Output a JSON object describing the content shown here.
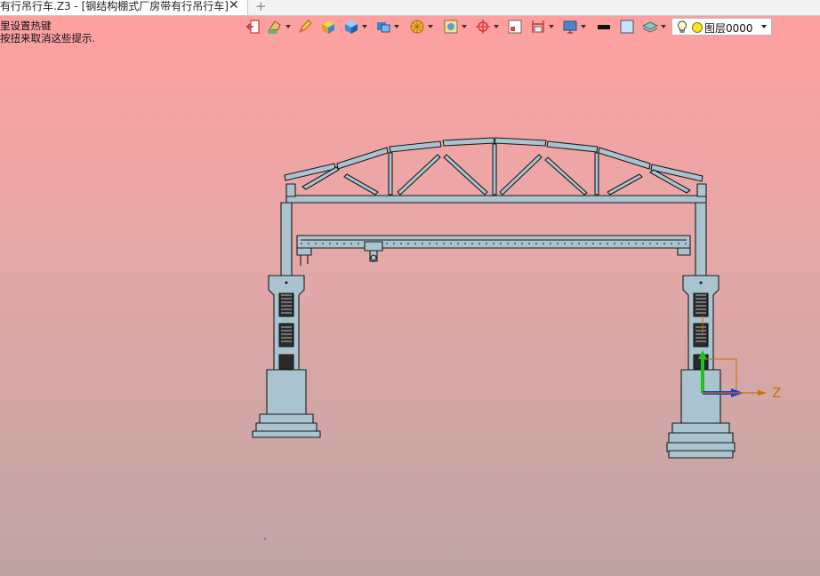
{
  "tab": {
    "title": "有行吊行车.Z3 - [钢结构棚式厂房带有行吊行车]",
    "close_glyph": "✕",
    "add_glyph": "+"
  },
  "hints": {
    "line1": "里设置热键",
    "line2": "按扭来取消这些提示."
  },
  "toolbar": {
    "buttons": [
      {
        "name": "exit-icon"
      },
      {
        "name": "paint-icon"
      },
      {
        "name": "pencil-icon"
      },
      {
        "name": "box-icon"
      },
      {
        "name": "cube-icon"
      },
      {
        "name": "view-cube-icon"
      },
      {
        "name": "render-mode-icon"
      },
      {
        "name": "frame-icon"
      },
      {
        "name": "target-icon"
      },
      {
        "name": "window-icon"
      },
      {
        "name": "dimension-icon"
      },
      {
        "name": "display-icon"
      },
      {
        "name": "line-color-icon"
      },
      {
        "name": "fill-color-icon"
      },
      {
        "name": "layer-stack-icon"
      }
    ],
    "layer": {
      "label": "图层0000",
      "bulb_color": "#f6e71c"
    }
  },
  "axis": {
    "z_label": "Z",
    "colors": {
      "y": "#1fc21f",
      "z": "#1a3fd9",
      "x": "#c77200"
    }
  },
  "colors": {
    "steel": "#a9c3cf",
    "steel_dark": "#8fb0bd",
    "outline": "#1a1a1a"
  }
}
